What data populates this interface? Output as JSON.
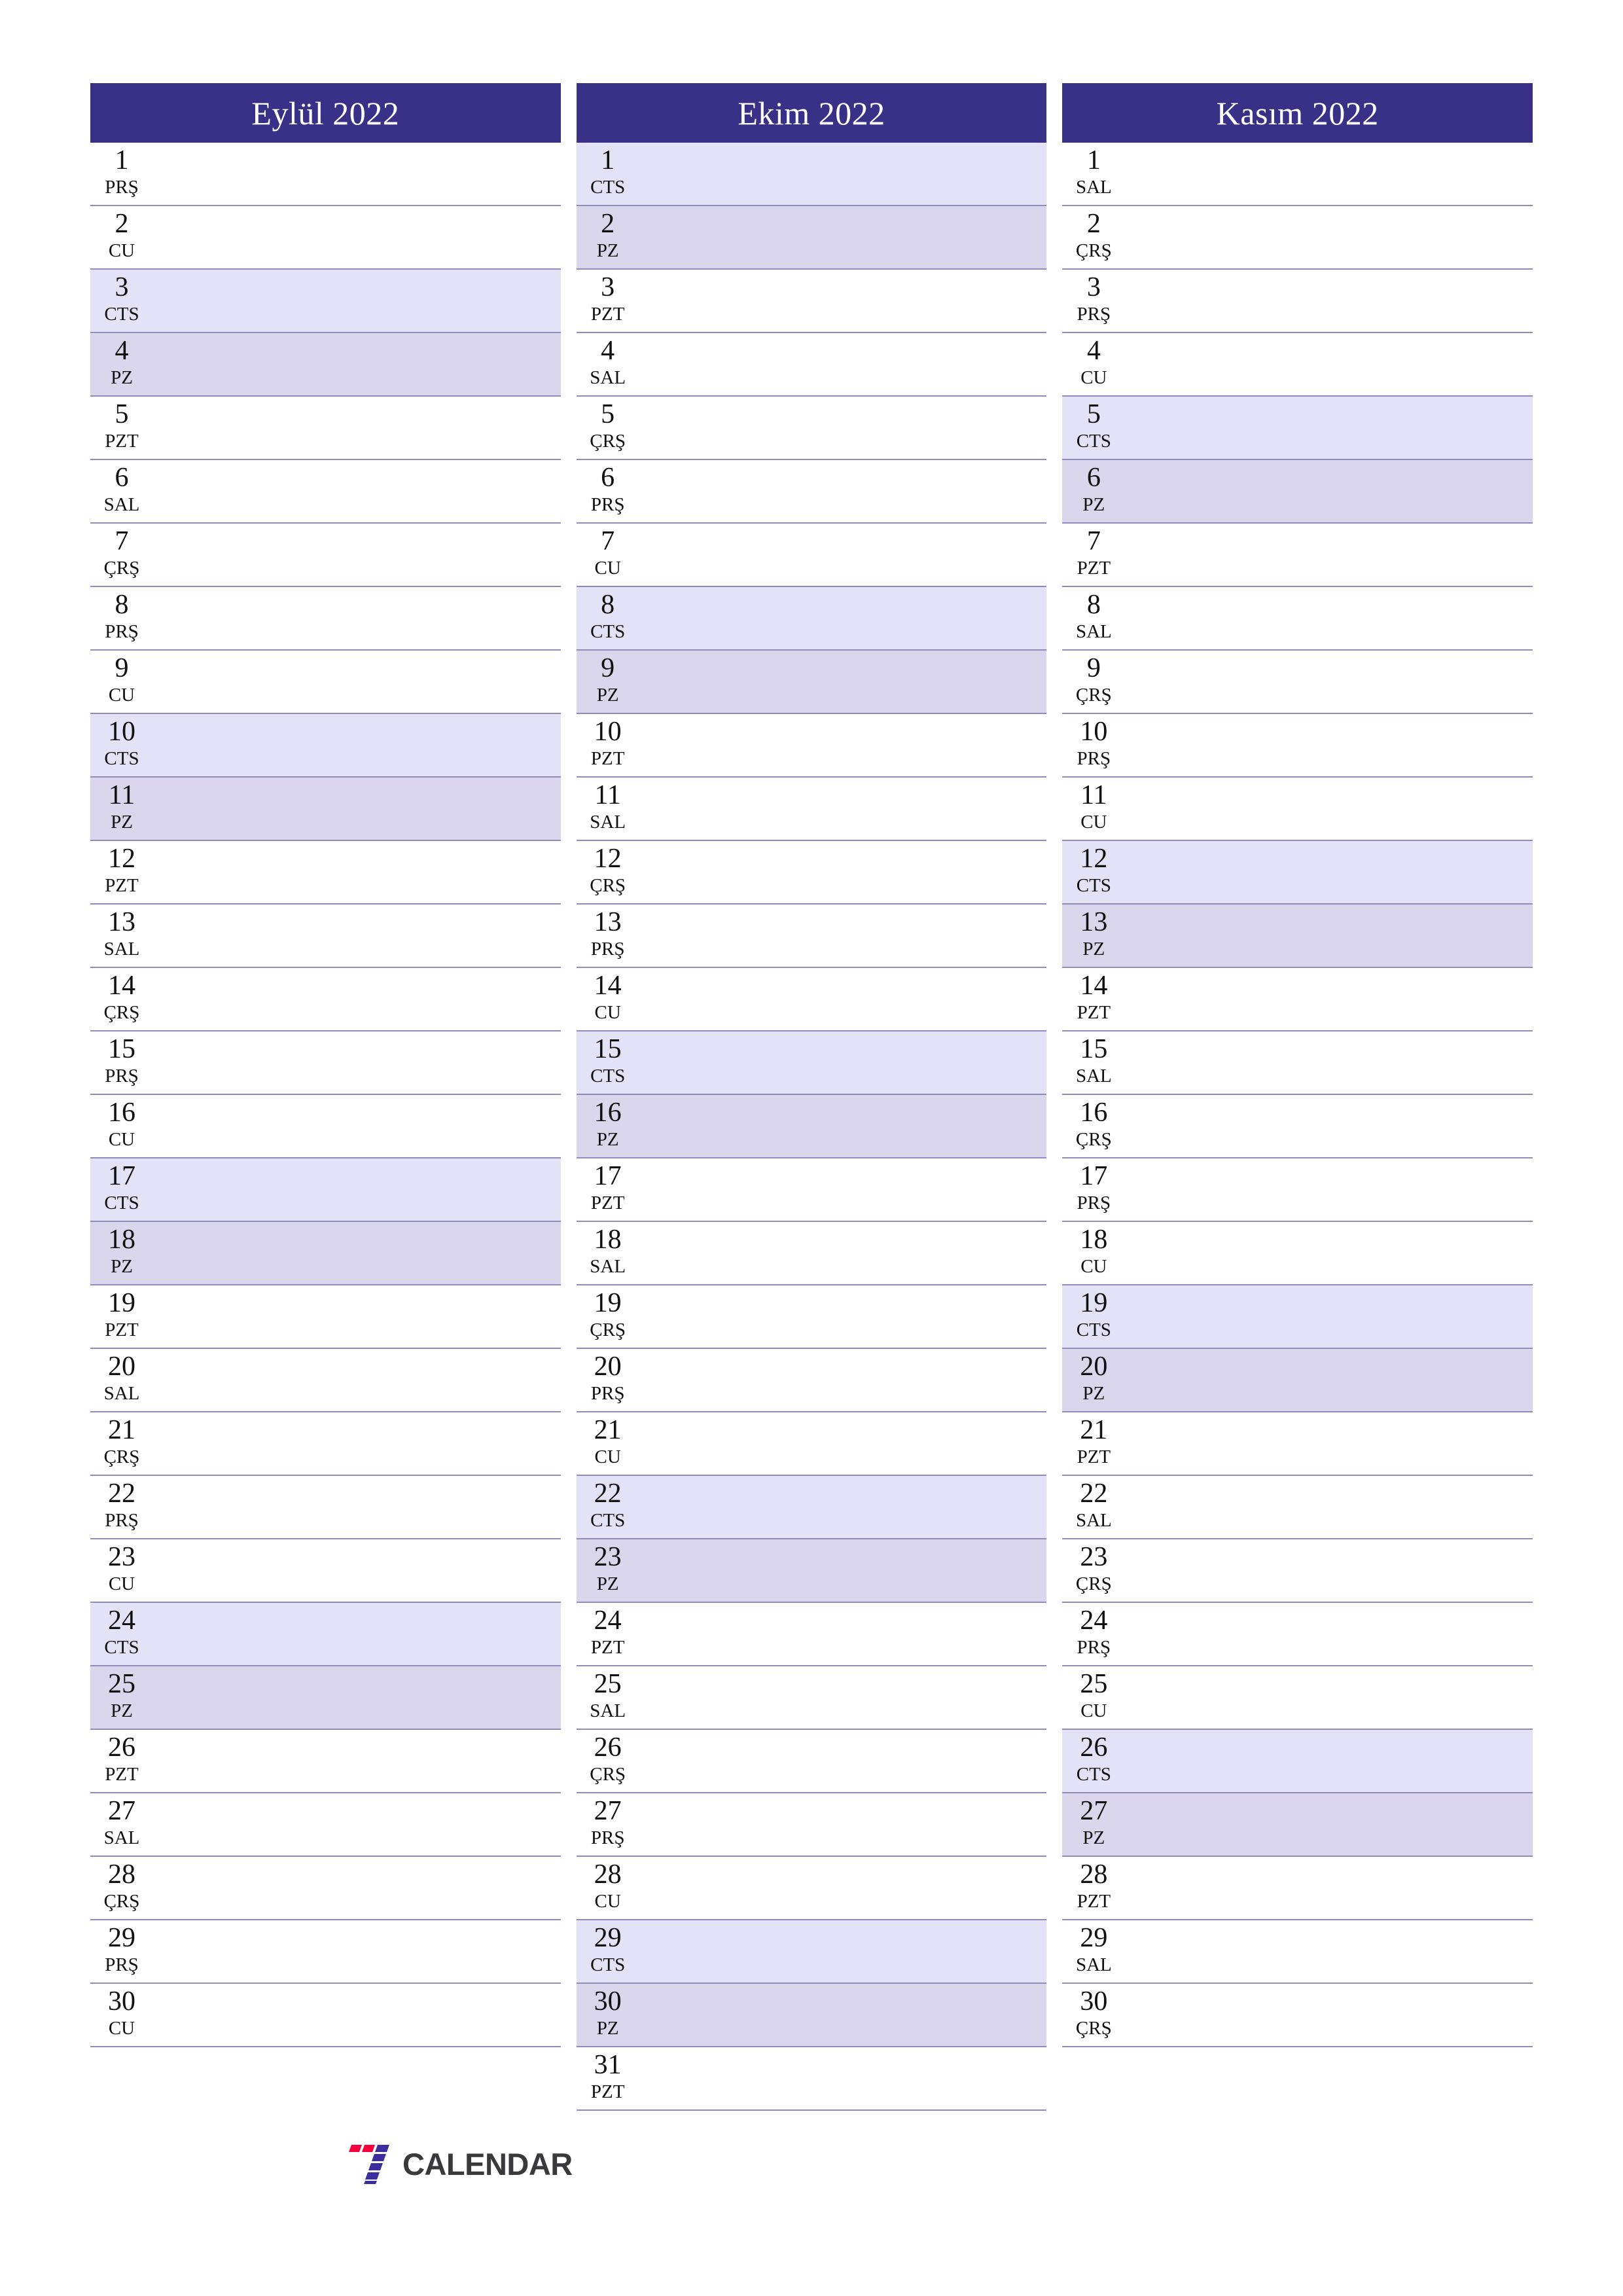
{
  "document": {
    "type": "printable-calendar-planner",
    "year": "2022",
    "language": "tr"
  },
  "colors": {
    "header_bg": "#383187",
    "header_text": "#ffffff",
    "saturday_bg": "#e3e2f7",
    "sunday_bg": "#dad6ec",
    "row_divider": "#8f8cba",
    "page_bg": "#ffffff",
    "logo_red": "#f5003c",
    "logo_indigo": "#3b2fa0",
    "logo_word": "#3a3a3c"
  },
  "brand": {
    "mark": "seven-logo-icon",
    "word": "CALENDAR"
  },
  "months": [
    {
      "title": "Eylül 2022",
      "days": [
        {
          "num": "1",
          "abbr": "PRŞ",
          "kind": "weekday"
        },
        {
          "num": "2",
          "abbr": "CU",
          "kind": "weekday"
        },
        {
          "num": "3",
          "abbr": "CTS",
          "kind": "sat"
        },
        {
          "num": "4",
          "abbr": "PZ",
          "kind": "sun"
        },
        {
          "num": "5",
          "abbr": "PZT",
          "kind": "weekday"
        },
        {
          "num": "6",
          "abbr": "SAL",
          "kind": "weekday"
        },
        {
          "num": "7",
          "abbr": "ÇRŞ",
          "kind": "weekday"
        },
        {
          "num": "8",
          "abbr": "PRŞ",
          "kind": "weekday"
        },
        {
          "num": "9",
          "abbr": "CU",
          "kind": "weekday"
        },
        {
          "num": "10",
          "abbr": "CTS",
          "kind": "sat"
        },
        {
          "num": "11",
          "abbr": "PZ",
          "kind": "sun"
        },
        {
          "num": "12",
          "abbr": "PZT",
          "kind": "weekday"
        },
        {
          "num": "13",
          "abbr": "SAL",
          "kind": "weekday"
        },
        {
          "num": "14",
          "abbr": "ÇRŞ",
          "kind": "weekday"
        },
        {
          "num": "15",
          "abbr": "PRŞ",
          "kind": "weekday"
        },
        {
          "num": "16",
          "abbr": "CU",
          "kind": "weekday"
        },
        {
          "num": "17",
          "abbr": "CTS",
          "kind": "sat"
        },
        {
          "num": "18",
          "abbr": "PZ",
          "kind": "sun"
        },
        {
          "num": "19",
          "abbr": "PZT",
          "kind": "weekday"
        },
        {
          "num": "20",
          "abbr": "SAL",
          "kind": "weekday"
        },
        {
          "num": "21",
          "abbr": "ÇRŞ",
          "kind": "weekday"
        },
        {
          "num": "22",
          "abbr": "PRŞ",
          "kind": "weekday"
        },
        {
          "num": "23",
          "abbr": "CU",
          "kind": "weekday"
        },
        {
          "num": "24",
          "abbr": "CTS",
          "kind": "sat"
        },
        {
          "num": "25",
          "abbr": "PZ",
          "kind": "sun"
        },
        {
          "num": "26",
          "abbr": "PZT",
          "kind": "weekday"
        },
        {
          "num": "27",
          "abbr": "SAL",
          "kind": "weekday"
        },
        {
          "num": "28",
          "abbr": "ÇRŞ",
          "kind": "weekday"
        },
        {
          "num": "29",
          "abbr": "PRŞ",
          "kind": "weekday"
        },
        {
          "num": "30",
          "abbr": "CU",
          "kind": "weekday"
        }
      ]
    },
    {
      "title": "Ekim 2022",
      "days": [
        {
          "num": "1",
          "abbr": "CTS",
          "kind": "sat"
        },
        {
          "num": "2",
          "abbr": "PZ",
          "kind": "sun"
        },
        {
          "num": "3",
          "abbr": "PZT",
          "kind": "weekday"
        },
        {
          "num": "4",
          "abbr": "SAL",
          "kind": "weekday"
        },
        {
          "num": "5",
          "abbr": "ÇRŞ",
          "kind": "weekday"
        },
        {
          "num": "6",
          "abbr": "PRŞ",
          "kind": "weekday"
        },
        {
          "num": "7",
          "abbr": "CU",
          "kind": "weekday"
        },
        {
          "num": "8",
          "abbr": "CTS",
          "kind": "sat"
        },
        {
          "num": "9",
          "abbr": "PZ",
          "kind": "sun"
        },
        {
          "num": "10",
          "abbr": "PZT",
          "kind": "weekday"
        },
        {
          "num": "11",
          "abbr": "SAL",
          "kind": "weekday"
        },
        {
          "num": "12",
          "abbr": "ÇRŞ",
          "kind": "weekday"
        },
        {
          "num": "13",
          "abbr": "PRŞ",
          "kind": "weekday"
        },
        {
          "num": "14",
          "abbr": "CU",
          "kind": "weekday"
        },
        {
          "num": "15",
          "abbr": "CTS",
          "kind": "sat"
        },
        {
          "num": "16",
          "abbr": "PZ",
          "kind": "sun"
        },
        {
          "num": "17",
          "abbr": "PZT",
          "kind": "weekday"
        },
        {
          "num": "18",
          "abbr": "SAL",
          "kind": "weekday"
        },
        {
          "num": "19",
          "abbr": "ÇRŞ",
          "kind": "weekday"
        },
        {
          "num": "20",
          "abbr": "PRŞ",
          "kind": "weekday"
        },
        {
          "num": "21",
          "abbr": "CU",
          "kind": "weekday"
        },
        {
          "num": "22",
          "abbr": "CTS",
          "kind": "sat"
        },
        {
          "num": "23",
          "abbr": "PZ",
          "kind": "sun"
        },
        {
          "num": "24",
          "abbr": "PZT",
          "kind": "weekday"
        },
        {
          "num": "25",
          "abbr": "SAL",
          "kind": "weekday"
        },
        {
          "num": "26",
          "abbr": "ÇRŞ",
          "kind": "weekday"
        },
        {
          "num": "27",
          "abbr": "PRŞ",
          "kind": "weekday"
        },
        {
          "num": "28",
          "abbr": "CU",
          "kind": "weekday"
        },
        {
          "num": "29",
          "abbr": "CTS",
          "kind": "sat"
        },
        {
          "num": "30",
          "abbr": "PZ",
          "kind": "sun"
        },
        {
          "num": "31",
          "abbr": "PZT",
          "kind": "weekday"
        }
      ]
    },
    {
      "title": "Kasım 2022",
      "days": [
        {
          "num": "1",
          "abbr": "SAL",
          "kind": "weekday"
        },
        {
          "num": "2",
          "abbr": "ÇRŞ",
          "kind": "weekday"
        },
        {
          "num": "3",
          "abbr": "PRŞ",
          "kind": "weekday"
        },
        {
          "num": "4",
          "abbr": "CU",
          "kind": "weekday"
        },
        {
          "num": "5",
          "abbr": "CTS",
          "kind": "sat"
        },
        {
          "num": "6",
          "abbr": "PZ",
          "kind": "sun"
        },
        {
          "num": "7",
          "abbr": "PZT",
          "kind": "weekday"
        },
        {
          "num": "8",
          "abbr": "SAL",
          "kind": "weekday"
        },
        {
          "num": "9",
          "abbr": "ÇRŞ",
          "kind": "weekday"
        },
        {
          "num": "10",
          "abbr": "PRŞ",
          "kind": "weekday"
        },
        {
          "num": "11",
          "abbr": "CU",
          "kind": "weekday"
        },
        {
          "num": "12",
          "abbr": "CTS",
          "kind": "sat"
        },
        {
          "num": "13",
          "abbr": "PZ",
          "kind": "sun"
        },
        {
          "num": "14",
          "abbr": "PZT",
          "kind": "weekday"
        },
        {
          "num": "15",
          "abbr": "SAL",
          "kind": "weekday"
        },
        {
          "num": "16",
          "abbr": "ÇRŞ",
          "kind": "weekday"
        },
        {
          "num": "17",
          "abbr": "PRŞ",
          "kind": "weekday"
        },
        {
          "num": "18",
          "abbr": "CU",
          "kind": "weekday"
        },
        {
          "num": "19",
          "abbr": "CTS",
          "kind": "sat"
        },
        {
          "num": "20",
          "abbr": "PZ",
          "kind": "sun"
        },
        {
          "num": "21",
          "abbr": "PZT",
          "kind": "weekday"
        },
        {
          "num": "22",
          "abbr": "SAL",
          "kind": "weekday"
        },
        {
          "num": "23",
          "abbr": "ÇRŞ",
          "kind": "weekday"
        },
        {
          "num": "24",
          "abbr": "PRŞ",
          "kind": "weekday"
        },
        {
          "num": "25",
          "abbr": "CU",
          "kind": "weekday"
        },
        {
          "num": "26",
          "abbr": "CTS",
          "kind": "sat"
        },
        {
          "num": "27",
          "abbr": "PZ",
          "kind": "sun"
        },
        {
          "num": "28",
          "abbr": "PZT",
          "kind": "weekday"
        },
        {
          "num": "29",
          "abbr": "SAL",
          "kind": "weekday"
        },
        {
          "num": "30",
          "abbr": "ÇRŞ",
          "kind": "weekday"
        }
      ]
    }
  ]
}
